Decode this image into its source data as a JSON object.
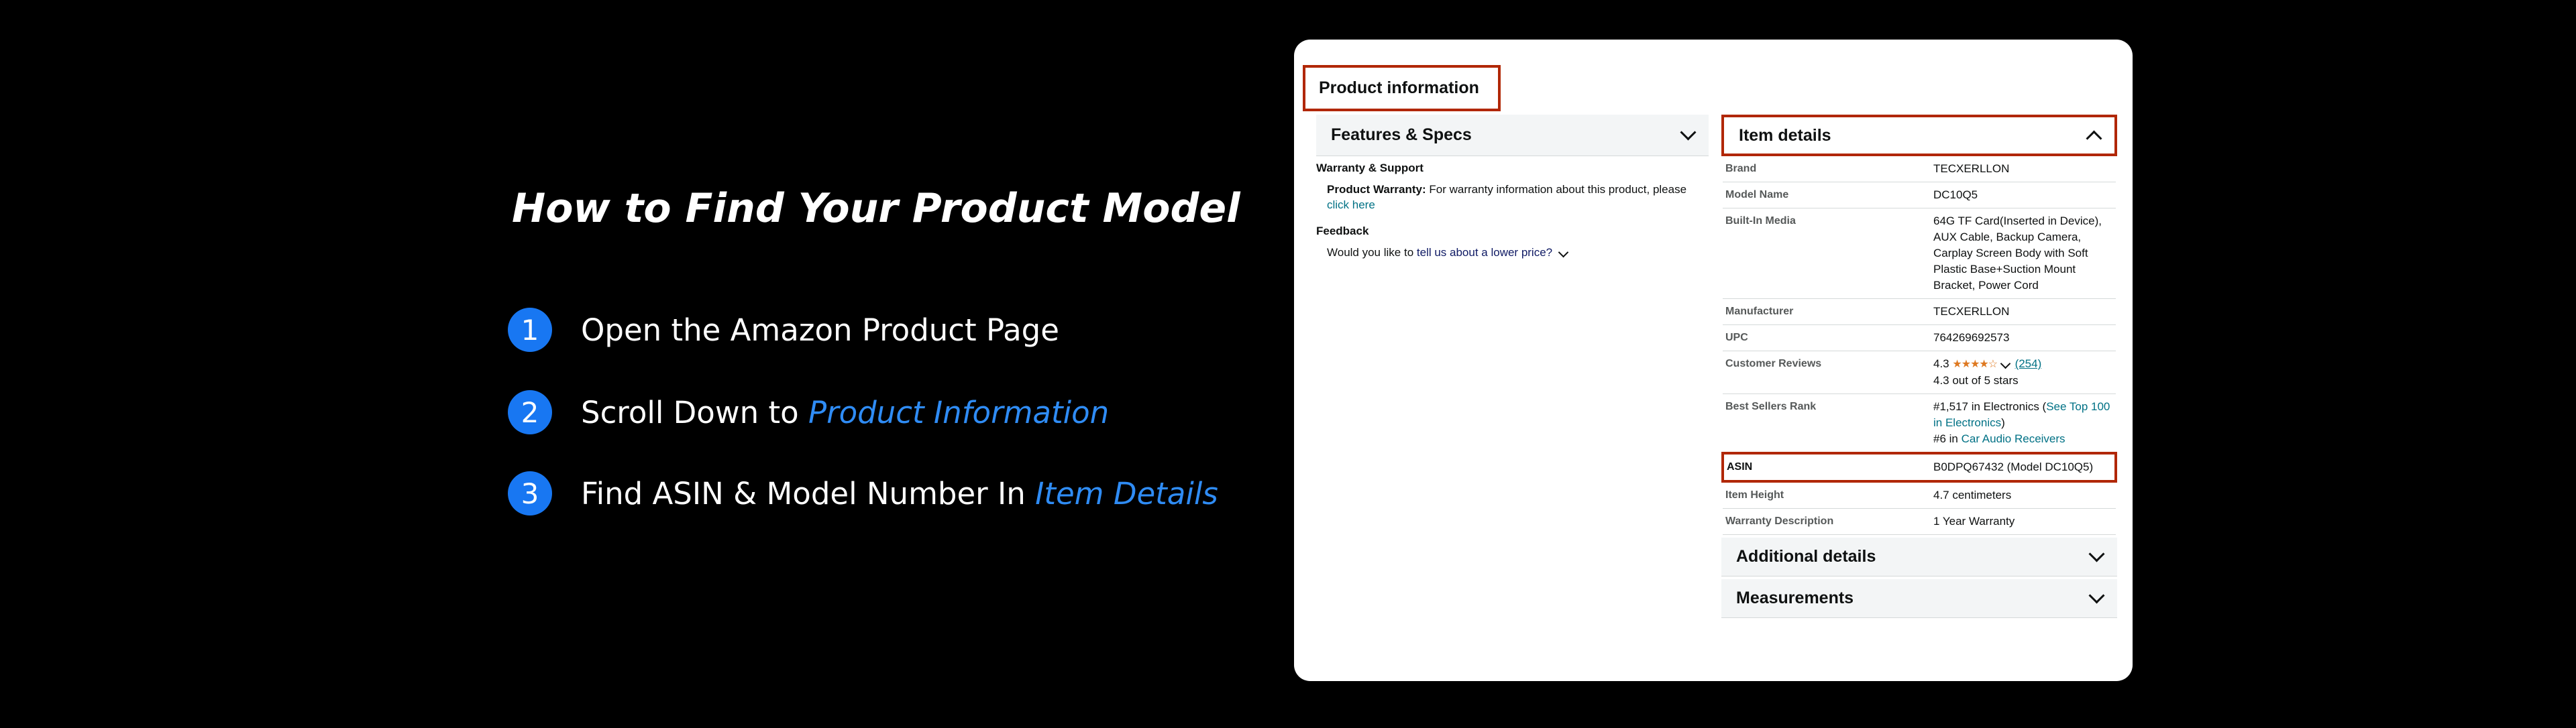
{
  "guide": {
    "title": "How to Find Your Product Model",
    "steps": [
      {
        "num": "1",
        "text": "Open the Amazon Product Page",
        "emphasis": ""
      },
      {
        "num": "2",
        "text": "Scroll Down to ",
        "emphasis": "Product Information"
      },
      {
        "num": "3",
        "text": "Find ASIN & Model Number In ",
        "emphasis": "Item Details"
      }
    ],
    "accent_color": "#1877f2"
  },
  "product_info": {
    "heading": "Product information",
    "features": {
      "title": "Features & Specs",
      "warranty_heading": "Warranty & Support",
      "warranty_label": "Product Warranty:",
      "warranty_text": "For warranty information about this product, please",
      "warranty_link": "click here",
      "feedback_heading": "Feedback",
      "feedback_text": "Would you like to",
      "feedback_link": "tell us about a lower price?"
    },
    "item_details": {
      "title": "Item details",
      "rows": [
        {
          "key": "Brand",
          "value": "TECXERLLON"
        },
        {
          "key": "Model Name",
          "value": "DC10Q5"
        },
        {
          "key": "Built-In Media",
          "value": "64G TF Card(Inserted in Device), AUX Cable, Backup Camera, Carplay Screen Body with Soft Plastic Base+Suction Mount Bracket, Power Cord"
        },
        {
          "key": "Manufacturer",
          "value": "TECXERLLON"
        },
        {
          "key": "UPC",
          "value": "764269692573"
        }
      ],
      "reviews": {
        "key": "Customer Reviews",
        "rating": "4.3",
        "stars": "★★★★☆",
        "count": "(254)",
        "summary": "4.3 out of 5 stars"
      },
      "rank": {
        "key": "Best Sellers Rank",
        "line1": "#1,517 in Electronics (",
        "line1_link": "See Top 100 in Electronics",
        "line1_end": ")",
        "line2": "#6 in ",
        "line2_link": "Car Audio Receivers"
      },
      "asin": {
        "key": "ASIN",
        "value": "B0DPQ67432 (Model DC10Q5)"
      },
      "rows_after": [
        {
          "key": "Item Height",
          "value": "4.7 centimeters"
        },
        {
          "key": "Warranty Description",
          "value": "1 Year Warranty"
        }
      ]
    },
    "additional_details": "Additional details",
    "measurements": "Measurements",
    "highlight_color": "#b12704"
  }
}
